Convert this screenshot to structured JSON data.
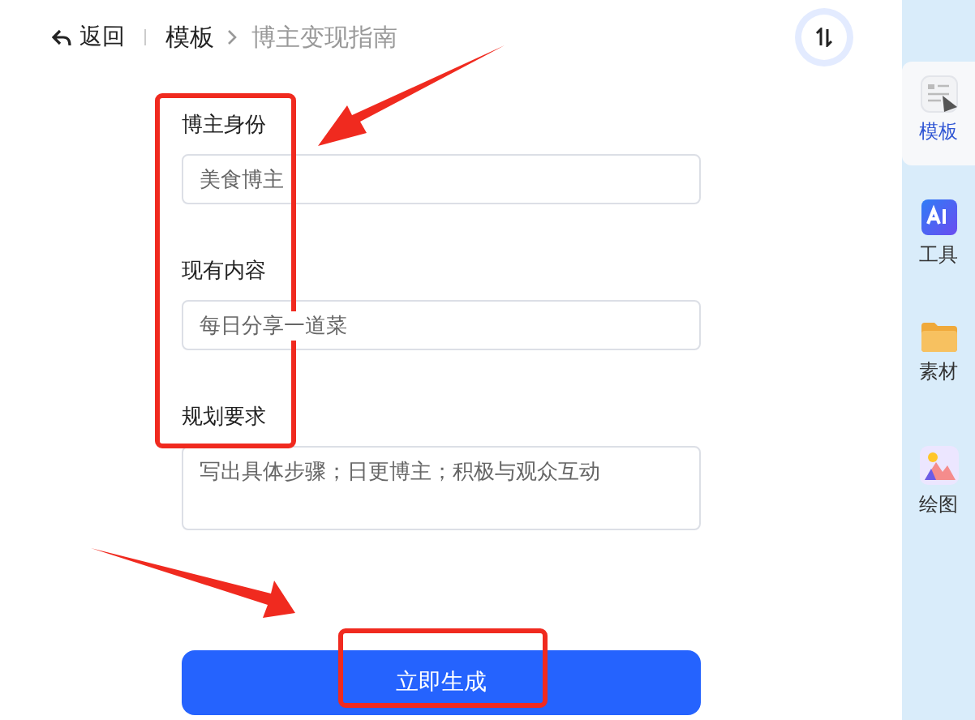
{
  "header": {
    "back": "返回",
    "breadcrumb": [
      {
        "label": "模板",
        "current": false
      },
      {
        "label": "博主变现指南",
        "current": true
      }
    ]
  },
  "form": {
    "fields": [
      {
        "label": "博主身份",
        "value": "美食博主",
        "kind": "input"
      },
      {
        "label": "现有内容",
        "value": "每日分享一道菜",
        "kind": "input"
      },
      {
        "label": "规划要求",
        "value": "写出具体步骤；日更博主；积极与观众互动",
        "kind": "textarea"
      }
    ],
    "submit": "立即生成"
  },
  "sidebar": {
    "items": [
      {
        "label": "模板",
        "selected": true,
        "kind": "template"
      },
      {
        "label": "工具",
        "selected": false,
        "kind": "ai"
      },
      {
        "label": "素材",
        "selected": false,
        "kind": "folder"
      },
      {
        "label": "绘图",
        "selected": false,
        "kind": "image"
      }
    ]
  }
}
